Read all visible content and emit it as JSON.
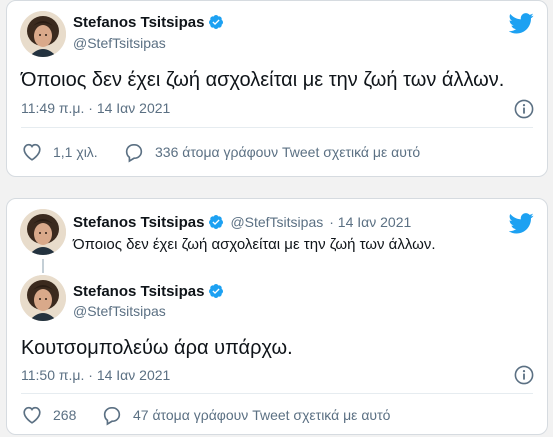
{
  "colors": {
    "twitter_blue": "#1da1f2",
    "text": "#0f1419",
    "secondary": "#5b7083"
  },
  "tweet1": {
    "author_name": "Stefanos Tsitsipas",
    "handle": "@StefTsitsipas",
    "text": "Όποιος δεν έχει ζωή ασχολείται με την ζωή των άλλων.",
    "timestamp": "11:49 π.μ. · 14 Ιαν 2021",
    "likes": "1,1 χιλ.",
    "replies": "336 άτομα γράφουν Tweet σχετικά με αυτό"
  },
  "tweet2": {
    "quoted": {
      "author_name": "Stefanos Tsitsipas",
      "handle": "@StefTsitsipas",
      "date": "· 14 Ιαν 2021",
      "text": "Όποιος δεν έχει ζωή ασχολείται με την ζωή των άλλων."
    },
    "author_name": "Stefanos Tsitsipas",
    "handle": "@StefTsitsipas",
    "text": "Κουτσομπολεύω άρα υπάρχω.",
    "timestamp": "11:50 π.μ. · 14 Ιαν 2021",
    "likes": "268",
    "replies": "47 άτομα γράφουν Tweet σχετικά με αυτό"
  },
  "icons": {
    "logo": "twitter-bird-icon",
    "verified": "verified-badge-icon",
    "info": "info-icon",
    "like": "heart-icon",
    "reply": "speech-bubble-icon"
  }
}
